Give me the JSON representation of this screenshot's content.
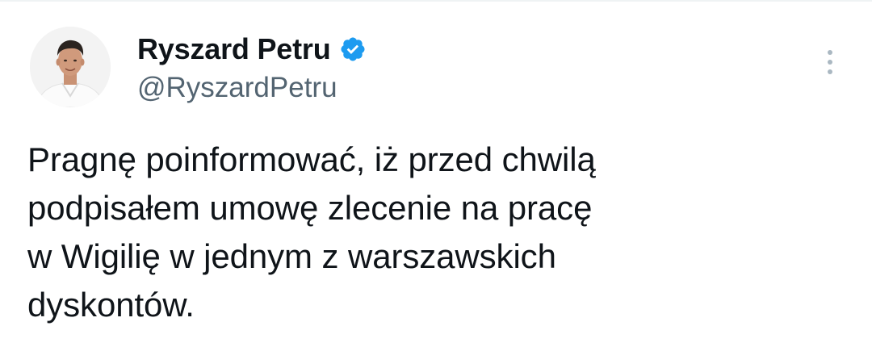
{
  "author": {
    "display_name": "Ryszard Petru",
    "handle": "@RyszardPetru",
    "verified": true,
    "avatar_icon": "profile-photo"
  },
  "actions": {
    "more_icon": "vertical-ellipsis-icon"
  },
  "tweet": {
    "text": "Pragnę poinformować, iż przed chwilą\npodpisałem umowę zlecenie na pracę\nw Wigilię w jednym z warszawskich\ndyskontów."
  },
  "colors": {
    "text_primary": "#0f1419",
    "text_secondary": "#536471",
    "verified_blue": "#1d9bf0",
    "icon_grey": "#aab8c2"
  }
}
